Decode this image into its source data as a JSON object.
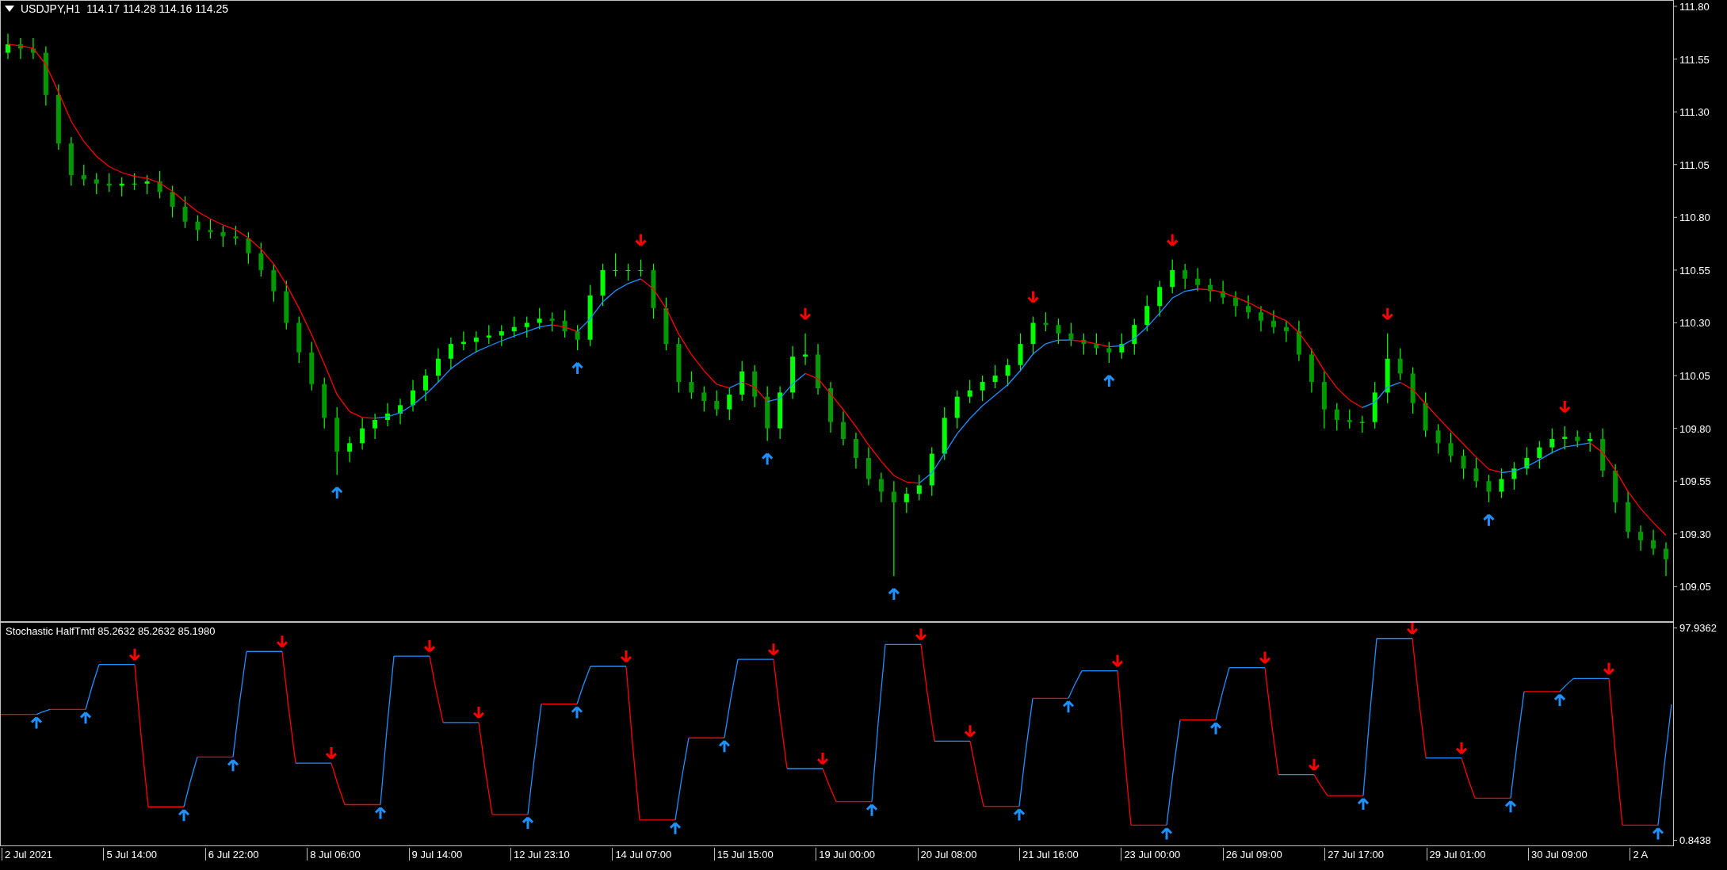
{
  "chart": {
    "symbol_timeframe": "USDJPY,H1",
    "ohlc_values": "114.17 114.28 114.16 114.25",
    "chart_data": {
      "type": "candlestick",
      "ylim": [
        108.89,
        111.83
      ],
      "yticks": [
        {
          "value": 111.8,
          "label": "111.80"
        },
        {
          "value": 111.55,
          "label": "111.55"
        },
        {
          "value": 111.3,
          "label": "111.30"
        },
        {
          "value": 111.05,
          "label": "111.05"
        },
        {
          "value": 110.8,
          "label": "110.80"
        },
        {
          "value": 110.55,
          "label": "110.55"
        },
        {
          "value": 110.3,
          "label": "110.30"
        },
        {
          "value": 110.05,
          "label": "110.05"
        },
        {
          "value": 109.8,
          "label": "109.80"
        },
        {
          "value": 109.55,
          "label": "109.55"
        },
        {
          "value": 109.3,
          "label": "109.30"
        },
        {
          "value": 109.05,
          "label": "109.05"
        }
      ],
      "categories": [
        null,
        null,
        null,
        null,
        null,
        null,
        null,
        null,
        null,
        null,
        null,
        null,
        null,
        null,
        null,
        null,
        null,
        null,
        null,
        null,
        null,
        null,
        null,
        null,
        null,
        null,
        null,
        null,
        null,
        null,
        null,
        null,
        null,
        null,
        null,
        null,
        null,
        null,
        null,
        null,
        null,
        null,
        null,
        null,
        null,
        null,
        null,
        null,
        null,
        null,
        null,
        null,
        null,
        null,
        null,
        null,
        null,
        null,
        null,
        null,
        null,
        null,
        null,
        null,
        null,
        null,
        null,
        null,
        null,
        null,
        null,
        null,
        null,
        null,
        null,
        null,
        null,
        null,
        null,
        null,
        null,
        null,
        null,
        null,
        null,
        null,
        null,
        null,
        null,
        null,
        null,
        null,
        null,
        null,
        null,
        null,
        null,
        null,
        null,
        null,
        null,
        null,
        null,
        null,
        null,
        null,
        null,
        null,
        null,
        null,
        null,
        null,
        null,
        null,
        null,
        null,
        null,
        null,
        null,
        null,
        null,
        null,
        null,
        null,
        null,
        null,
        null,
        null,
        null,
        null,
        null,
        null
      ],
      "ohlc": [
        [
          111.58,
          111.67,
          111.55,
          111.62
        ],
        [
          111.62,
          111.65,
          111.55,
          111.6
        ],
        [
          111.6,
          111.65,
          111.55,
          111.58
        ],
        [
          111.58,
          111.61,
          111.33,
          111.38
        ],
        [
          111.38,
          111.43,
          111.12,
          111.15
        ],
        [
          111.15,
          111.18,
          110.95,
          111.0
        ],
        [
          111.0,
          111.05,
          110.95,
          110.98
        ],
        [
          110.98,
          111.01,
          110.91,
          110.96
        ],
        [
          110.96,
          111.01,
          110.92,
          110.95
        ],
        [
          110.95,
          110.99,
          110.9,
          110.96
        ],
        [
          110.96,
          111.01,
          110.93,
          110.96
        ],
        [
          110.96,
          111.0,
          110.91,
          110.97
        ],
        [
          110.97,
          111.02,
          110.89,
          110.92
        ],
        [
          110.92,
          110.95,
          110.8,
          110.85
        ],
        [
          110.85,
          110.9,
          110.75,
          110.78
        ],
        [
          110.78,
          110.81,
          110.69,
          110.74
        ],
        [
          110.74,
          110.79,
          110.7,
          110.73
        ],
        [
          110.73,
          110.76,
          110.66,
          110.71
        ],
        [
          110.71,
          110.76,
          110.67,
          110.7
        ],
        [
          110.7,
          110.73,
          110.58,
          110.63
        ],
        [
          110.63,
          110.68,
          110.52,
          110.55
        ],
        [
          110.55,
          110.58,
          110.4,
          110.45
        ],
        [
          110.45,
          110.5,
          110.27,
          110.3
        ],
        [
          110.3,
          110.33,
          110.11,
          110.16
        ],
        [
          110.16,
          110.21,
          109.98,
          110.01
        ],
        [
          110.01,
          110.04,
          109.8,
          109.85
        ],
        [
          109.85,
          109.9,
          109.58,
          109.69
        ],
        [
          109.69,
          109.76,
          109.64,
          109.73
        ],
        [
          109.73,
          109.85,
          109.7,
          109.8
        ],
        [
          109.8,
          109.87,
          109.75,
          109.84
        ],
        [
          109.84,
          109.92,
          109.81,
          109.87
        ],
        [
          109.87,
          109.94,
          109.82,
          109.91
        ],
        [
          109.91,
          110.03,
          109.88,
          109.98
        ],
        [
          109.98,
          110.08,
          109.93,
          110.05
        ],
        [
          110.05,
          110.18,
          110.02,
          110.13
        ],
        [
          110.13,
          110.23,
          110.08,
          110.2
        ],
        [
          110.2,
          110.26,
          110.17,
          110.21
        ],
        [
          110.21,
          110.26,
          110.16,
          110.23
        ],
        [
          110.23,
          110.29,
          110.2,
          110.24
        ],
        [
          110.24,
          110.29,
          110.19,
          110.26
        ],
        [
          110.26,
          110.33,
          110.23,
          110.28
        ],
        [
          110.28,
          110.33,
          110.23,
          110.3
        ],
        [
          110.3,
          110.37,
          110.27,
          110.32
        ],
        [
          110.32,
          110.35,
          110.26,
          110.31
        ],
        [
          110.31,
          110.36,
          110.23,
          110.26
        ],
        [
          110.26,
          110.29,
          110.17,
          110.22
        ],
        [
          110.22,
          110.48,
          110.19,
          110.43
        ],
        [
          110.43,
          110.58,
          110.38,
          110.55
        ],
        [
          110.55,
          110.63,
          110.52,
          110.55
        ],
        [
          110.55,
          110.58,
          110.5,
          110.55
        ],
        [
          110.55,
          110.6,
          110.52,
          110.55
        ],
        [
          110.55,
          110.58,
          110.32,
          110.37
        ],
        [
          110.37,
          110.42,
          110.17,
          110.2
        ],
        [
          110.2,
          110.23,
          109.97,
          110.02
        ],
        [
          110.02,
          110.07,
          109.94,
          109.97
        ],
        [
          109.97,
          110.0,
          109.88,
          109.93
        ],
        [
          109.93,
          109.98,
          109.86,
          109.89
        ],
        [
          109.89,
          109.99,
          109.84,
          109.96
        ],
        [
          109.96,
          110.12,
          109.93,
          110.07
        ],
        [
          110.07,
          110.1,
          109.9,
          109.95
        ],
        [
          109.95,
          110.0,
          109.74,
          109.8
        ],
        [
          109.8,
          110.0,
          109.75,
          109.97
        ],
        [
          109.97,
          110.19,
          109.94,
          110.14
        ],
        [
          110.14,
          110.25,
          110.1,
          110.15
        ],
        [
          110.15,
          110.2,
          109.96,
          109.99
        ],
        [
          109.99,
          110.02,
          109.78,
          109.83
        ],
        [
          109.83,
          109.88,
          109.72,
          109.75
        ],
        [
          109.75,
          109.78,
          109.61,
          109.66
        ],
        [
          109.66,
          109.71,
          109.53,
          109.56
        ],
        [
          109.56,
          109.59,
          109.45,
          109.5
        ],
        [
          109.5,
          109.55,
          109.1,
          109.45
        ],
        [
          109.45,
          109.52,
          109.4,
          109.49
        ],
        [
          109.49,
          109.58,
          109.46,
          109.53
        ],
        [
          109.53,
          109.71,
          109.48,
          109.68
        ],
        [
          109.68,
          109.9,
          109.65,
          109.85
        ],
        [
          109.85,
          109.98,
          109.8,
          109.95
        ],
        [
          109.95,
          110.03,
          109.92,
          109.98
        ],
        [
          109.98,
          110.05,
          109.93,
          110.02
        ],
        [
          110.02,
          110.1,
          109.99,
          110.05
        ],
        [
          110.05,
          110.13,
          110.0,
          110.1
        ],
        [
          110.1,
          110.25,
          110.07,
          110.2
        ],
        [
          110.2,
          110.33,
          110.15,
          110.3
        ],
        [
          110.3,
          110.35,
          110.26,
          110.29
        ],
        [
          110.29,
          110.32,
          110.2,
          110.25
        ],
        [
          110.25,
          110.3,
          110.19,
          110.22
        ],
        [
          110.22,
          110.25,
          110.15,
          110.2
        ],
        [
          110.2,
          110.25,
          110.15,
          110.18
        ],
        [
          110.18,
          110.21,
          110.11,
          110.16
        ],
        [
          110.16,
          110.25,
          110.13,
          110.2
        ],
        [
          110.2,
          110.32,
          110.15,
          110.29
        ],
        [
          110.29,
          110.43,
          110.26,
          110.38
        ],
        [
          110.38,
          110.5,
          110.33,
          110.47
        ],
        [
          110.47,
          110.6,
          110.44,
          110.55
        ],
        [
          110.55,
          110.58,
          110.46,
          110.51
        ],
        [
          110.51,
          110.56,
          110.45,
          110.48
        ],
        [
          110.48,
          110.51,
          110.4,
          110.45
        ],
        [
          110.45,
          110.5,
          110.39,
          110.42
        ],
        [
          110.42,
          110.45,
          110.33,
          110.38
        ],
        [
          110.38,
          110.43,
          110.32,
          110.35
        ],
        [
          110.35,
          110.38,
          110.26,
          110.31
        ],
        [
          110.31,
          110.36,
          110.25,
          110.28
        ],
        [
          110.28,
          110.31,
          110.21,
          110.26
        ],
        [
          110.26,
          110.31,
          110.12,
          110.15
        ],
        [
          110.15,
          110.18,
          109.97,
          110.02
        ],
        [
          110.02,
          110.07,
          109.8,
          109.89
        ],
        [
          109.89,
          109.92,
          109.79,
          109.84
        ],
        [
          109.84,
          109.89,
          109.8,
          109.83
        ],
        [
          109.83,
          109.86,
          109.78,
          109.83
        ],
        [
          109.83,
          110.02,
          109.8,
          109.97
        ],
        [
          109.97,
          110.25,
          109.92,
          110.13
        ],
        [
          110.13,
          110.18,
          110.03,
          110.06
        ],
        [
          110.06,
          110.09,
          109.87,
          109.92
        ],
        [
          109.92,
          109.97,
          109.76,
          109.79
        ],
        [
          109.79,
          109.82,
          109.68,
          109.73
        ],
        [
          109.73,
          109.78,
          109.64,
          109.67
        ],
        [
          109.67,
          109.7,
          109.56,
          109.61
        ],
        [
          109.61,
          109.66,
          109.52,
          109.55
        ],
        [
          109.55,
          109.58,
          109.45,
          109.5
        ],
        [
          109.5,
          109.61,
          109.47,
          109.56
        ],
        [
          109.56,
          109.64,
          109.51,
          109.61
        ],
        [
          109.61,
          109.71,
          109.58,
          109.66
        ],
        [
          109.66,
          109.74,
          109.61,
          109.71
        ],
        [
          109.71,
          109.8,
          109.68,
          109.75
        ],
        [
          109.75,
          109.81,
          109.7,
          109.76
        ],
        [
          109.76,
          109.79,
          109.71,
          109.74
        ],
        [
          109.74,
          109.78,
          109.69,
          109.75
        ],
        [
          109.75,
          109.8,
          109.57,
          109.6
        ],
        [
          109.6,
          109.63,
          109.4,
          109.45
        ],
        [
          109.45,
          109.5,
          109.28,
          109.31
        ],
        [
          109.31,
          109.34,
          109.22,
          109.27
        ],
        [
          109.27,
          109.32,
          109.2,
          109.23
        ],
        [
          109.23,
          109.26,
          109.1,
          109.18
        ]
      ]
    }
  },
  "time_axis": [
    "2 Jul 2021",
    "5 Jul 14:00",
    "6 Jul 22:00",
    "8 Jul 06:00",
    "9 Jul 14:00",
    "12 Jul 23:10",
    "14 Jul 07:00",
    "15 Jul 15:00",
    "19 Jul 00:00",
    "20 Jul 08:00",
    "21 Jul 16:00",
    "23 Jul 00:00",
    "26 Jul 09:00",
    "27 Jul 17:00",
    "29 Jul 01:00",
    "30 Jul 09:00",
    "2 A"
  ],
  "indicator": {
    "label": "Stochastic HalfTmtf 85.2632 85.2632 85.1980",
    "axis": [
      "97.9362",
      "0.8438"
    ]
  }
}
